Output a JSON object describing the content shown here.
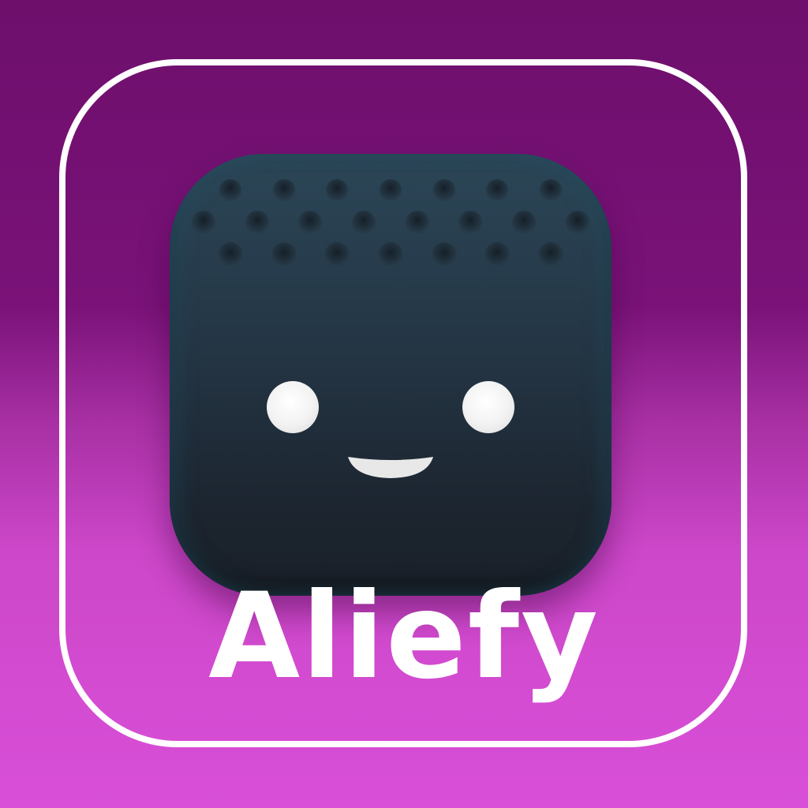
{
  "app": {
    "name": "Aliefy",
    "icon": "robot-face-icon"
  },
  "colors": {
    "background_top": "#6e0f6c",
    "background_bottom": "#d94fd8",
    "tile_border": "#ffffff",
    "icon_body": "#243544",
    "icon_eyes": "#f2f2f2",
    "label": "#ffffff"
  }
}
